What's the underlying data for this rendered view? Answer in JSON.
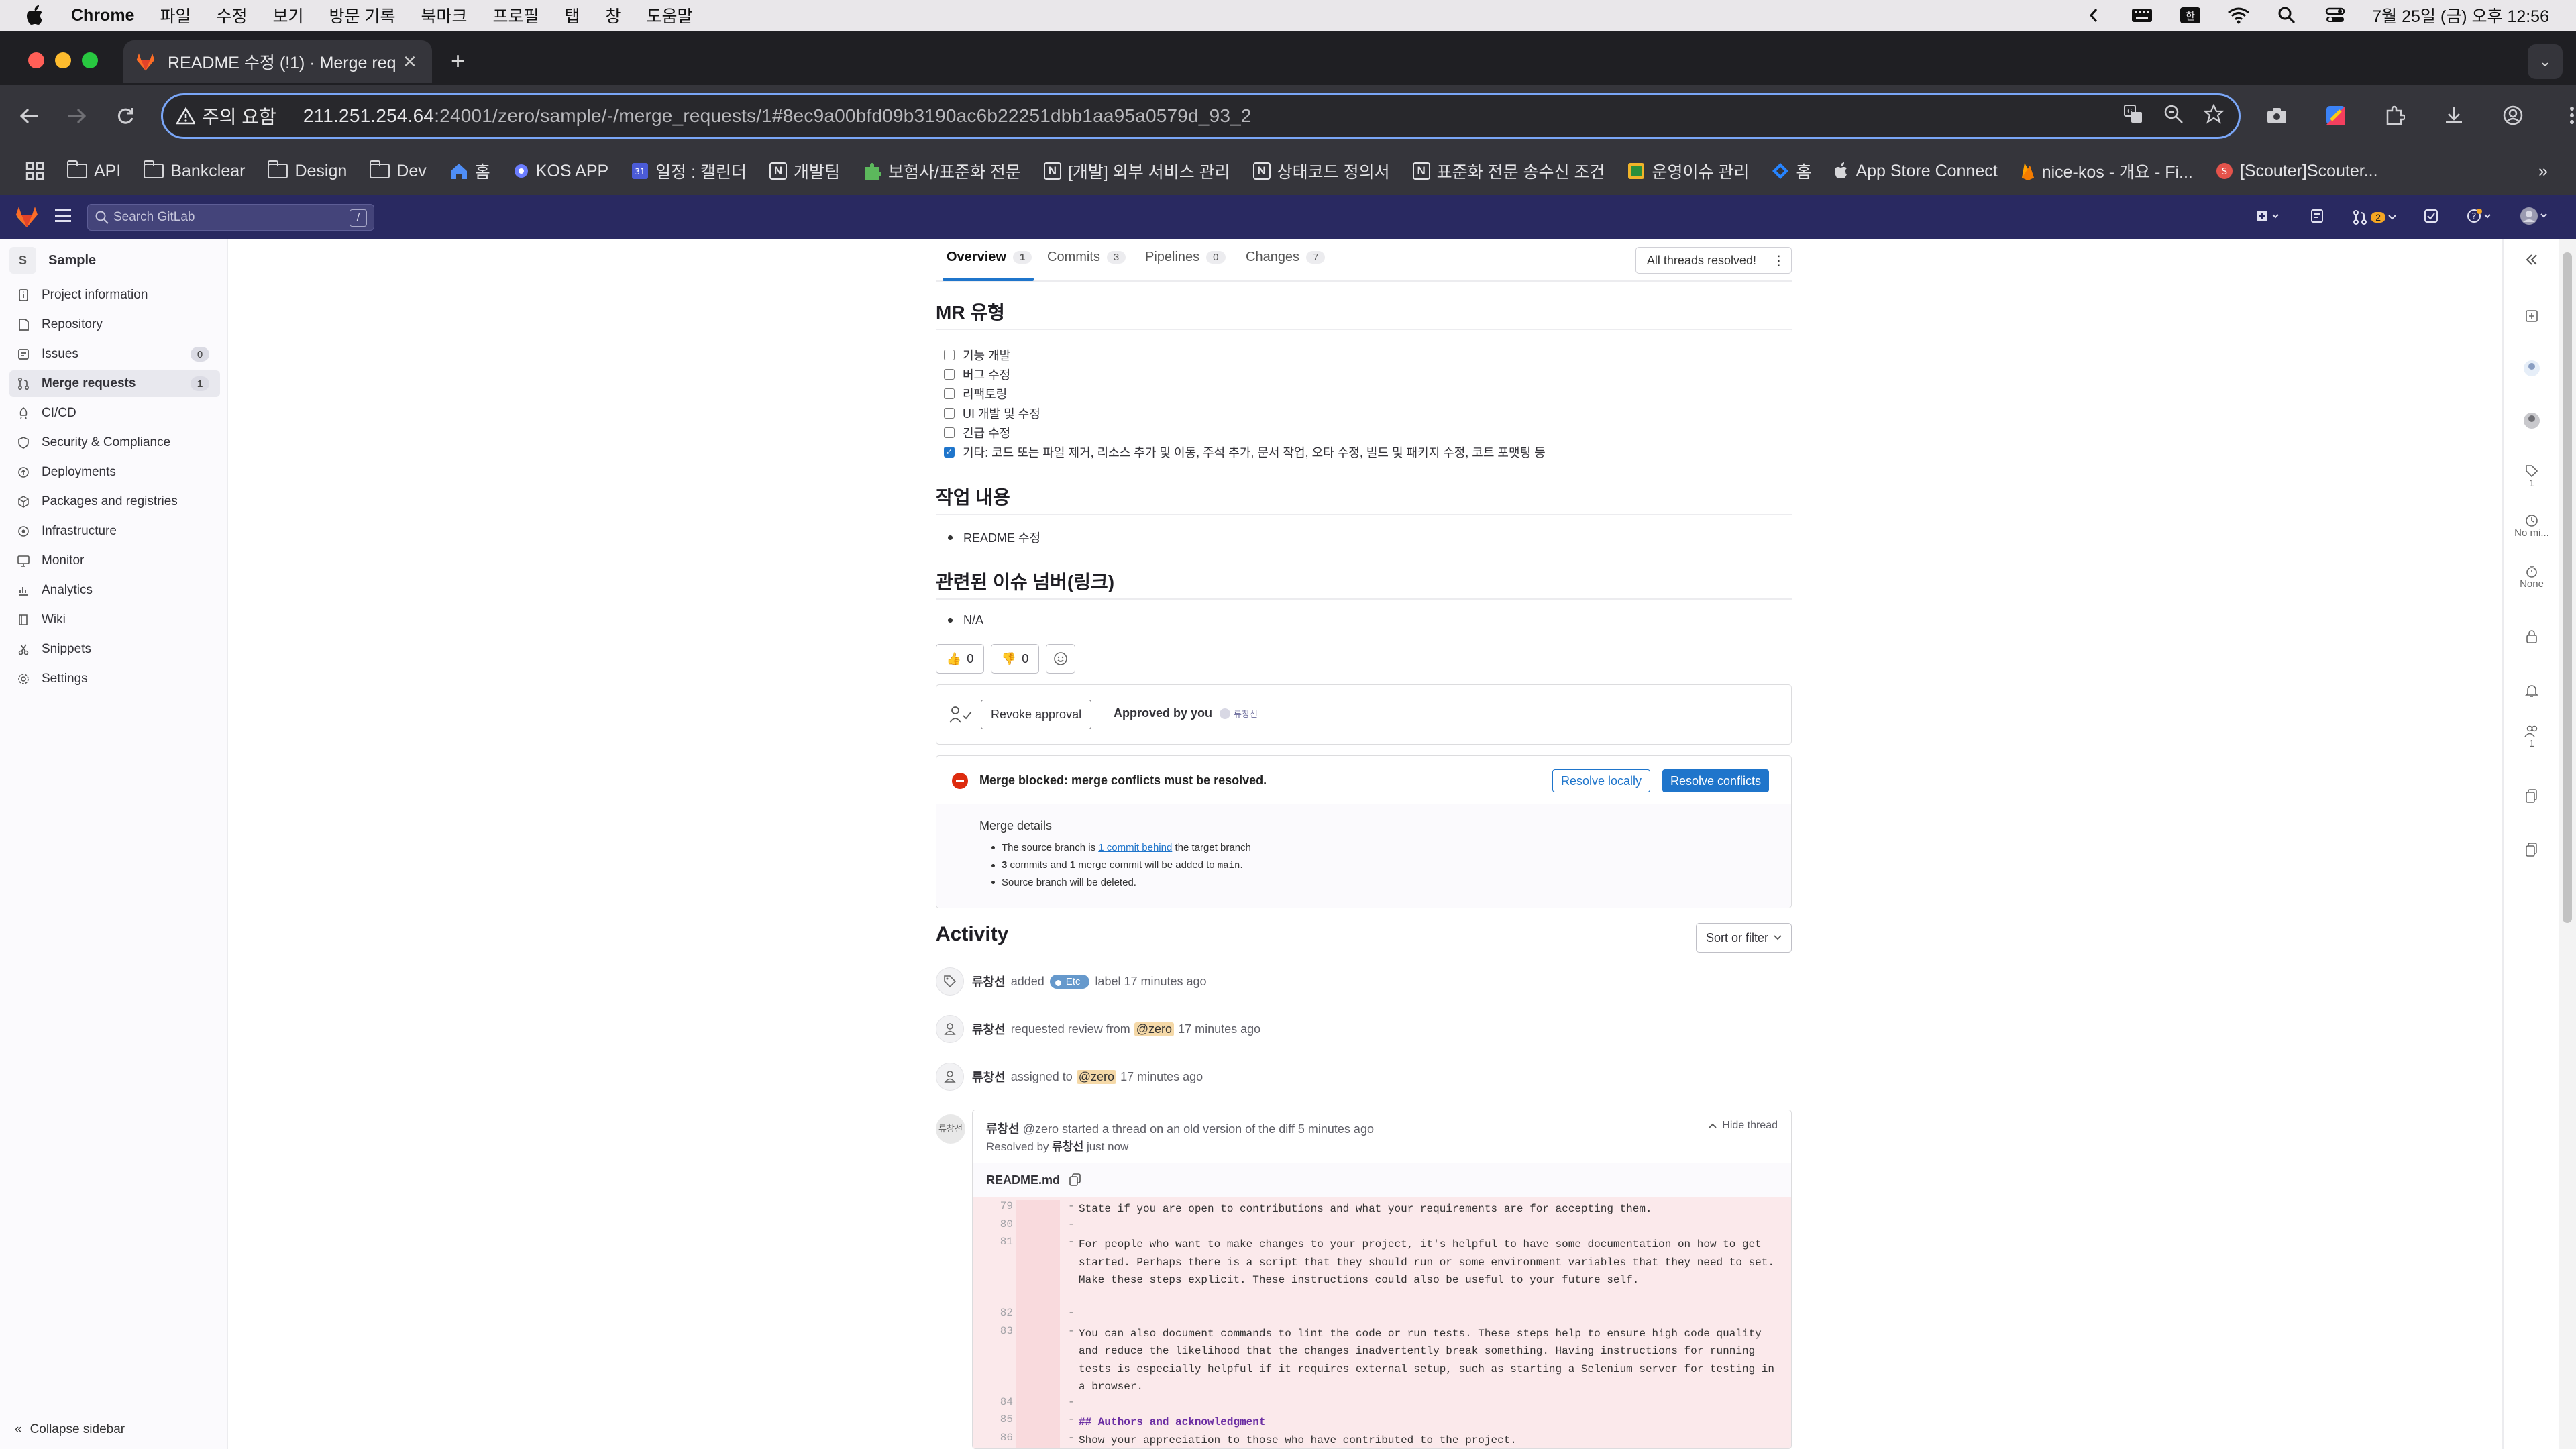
{
  "menubar": {
    "items": [
      "Chrome",
      "파일",
      "수정",
      "보기",
      "방문 기록",
      "북마크",
      "프로필",
      "탭",
      "창",
      "도움말"
    ],
    "datetime": "7월 25일 (금) 오후 12:56"
  },
  "browser": {
    "tab_title": "README 수정 (!1) · Merge requ",
    "warning": "주의 요함",
    "url_host": "211.251.254.64",
    "url_rest": ":24001/zero/sample/-/merge_requests/1#8ec9a00bfd09b3190ac6b22251dbb1aa95a0579d_93_2",
    "bookmarks": [
      {
        "label": "API",
        "icon": "folder-icon"
      },
      {
        "label": "Bankclear",
        "icon": "folder-icon"
      },
      {
        "label": "Design",
        "icon": "folder-icon"
      },
      {
        "label": "Dev",
        "icon": "folder-icon"
      },
      {
        "label": "홈",
        "icon": "home-icon"
      },
      {
        "label": "KOS APP",
        "icon": "app-icon"
      },
      {
        "label": "일정 : 캘린더",
        "icon": "calendar-icon"
      },
      {
        "label": "개발팀",
        "icon": "notion-icon"
      },
      {
        "label": "보험사/표준화 전문",
        "icon": "puzzle-icon"
      },
      {
        "label": "[개발] 외부 서비스 관리",
        "icon": "notion-icon"
      },
      {
        "label": "상태코드 정의서",
        "icon": "notion-icon"
      },
      {
        "label": "표준화 전문 송수신 조건",
        "icon": "notion-icon"
      },
      {
        "label": "운영이슈 관리",
        "icon": "sheet-icon"
      },
      {
        "label": "홈",
        "icon": "jira-icon"
      },
      {
        "label": "App Store Connect",
        "icon": "apple-icon"
      },
      {
        "label": "nice-kos - 개요 - Fi...",
        "icon": "firebase-icon"
      },
      {
        "label": "[Scouter]Scouter...",
        "icon": "scouter-icon"
      }
    ]
  },
  "gitlab": {
    "search_placeholder": "Search GitLab",
    "search_shortcut": "/",
    "merge_request_count": "2",
    "project": {
      "initial": "S",
      "name": "Sample"
    },
    "nav": [
      {
        "label": "Project information",
        "icon": "info-icon"
      },
      {
        "label": "Repository",
        "icon": "doc-icon"
      },
      {
        "label": "Issues",
        "icon": "issues-icon",
        "badge": "0"
      },
      {
        "label": "Merge requests",
        "icon": "merge-icon",
        "badge": "1",
        "active": true
      },
      {
        "label": "CI/CD",
        "icon": "rocket-icon"
      },
      {
        "label": "Security & Compliance",
        "icon": "shield-icon"
      },
      {
        "label": "Deployments",
        "icon": "deploy-icon"
      },
      {
        "label": "Packages and registries",
        "icon": "package-icon"
      },
      {
        "label": "Infrastructure",
        "icon": "cloud-icon"
      },
      {
        "label": "Monitor",
        "icon": "monitor-icon"
      },
      {
        "label": "Analytics",
        "icon": "chart-icon"
      },
      {
        "label": "Wiki",
        "icon": "book-icon"
      },
      {
        "label": "Snippets",
        "icon": "scissors-icon"
      },
      {
        "label": "Settings",
        "icon": "gear-icon"
      }
    ],
    "collapse_label": "Collapse sidebar"
  },
  "mr": {
    "tabs": [
      {
        "label": "Overview",
        "count": "1"
      },
      {
        "label": "Commits",
        "count": "3"
      },
      {
        "label": "Pipelines",
        "count": "0"
      },
      {
        "label": "Changes",
        "count": "7"
      }
    ],
    "threads_status": "All threads resolved!",
    "section1": "MR 유형",
    "checklist": [
      {
        "label": "기능 개발",
        "checked": false
      },
      {
        "label": "버그 수정",
        "checked": false
      },
      {
        "label": "리팩토링",
        "checked": false
      },
      {
        "label": "UI 개발 및 수정",
        "checked": false
      },
      {
        "label": "긴급 수정",
        "checked": false
      },
      {
        "label": "기타: 코드 또는 파일 제거, 리소스 추가 및 이동, 주석 추가, 문서 작업, 오타 수정, 빌드 및 패키지 수정, 코트 포맷팅 등",
        "checked": true
      }
    ],
    "section2": "작업 내용",
    "work_item": "README 수정",
    "section3": "관련된 이슈 넘버(링크)",
    "issue_item": "N/A",
    "thumbs_up": "0",
    "thumbs_down": "0",
    "revoke_label": "Revoke approval",
    "approved_by": "Approved by you",
    "approver_name": "류창선",
    "merge_blocked": "Merge blocked: merge conflicts must be resolved.",
    "resolve_locally": "Resolve locally",
    "resolve_conflicts": "Resolve conflicts",
    "merge_details_title": "Merge details",
    "md1_pre": "The source branch is ",
    "md1_link": "1 commit behind",
    "md1_post": " the target branch",
    "md2_a": "3",
    "md2_b": " commits and ",
    "md2_c": "1",
    "md2_d": " merge commit will be added to ",
    "md2_e": "main",
    "md2_f": ".",
    "md3": "Source branch will be deleted."
  },
  "activity": {
    "title": "Activity",
    "sort_label": "Sort or filter",
    "user": "류창선",
    "e1_action": "added",
    "e1_label": "Etc",
    "e1_rest": "label 17 minutes ago",
    "e2_action": "requested review from",
    "e2_mention": "@zero",
    "e2_time": "17 minutes ago",
    "e3_action": "assigned to",
    "e3_mention": "@zero",
    "e3_time": "17 minutes ago",
    "thread_avatar": "류창선",
    "thread_user": "류창선",
    "thread_text": "@zero started a thread on an old version of the diff 5 minutes ago",
    "resolved_prefix": "Resolved by",
    "resolved_user": "류창선",
    "resolved_time": "just now",
    "hide_thread": "Hide thread",
    "file": "README.md",
    "diff": [
      {
        "n": "79",
        "text": "State if you are open to contributions and what your requirements are for accepting them.",
        "rows": 1
      },
      {
        "n": "80",
        "text": "",
        "rows": 1
      },
      {
        "n": "81",
        "text": "For people who want to make changes to your project, it's helpful to have some documentation on how to get started. Perhaps there is a script that they should run or some environment variables that they need to set. Make these steps explicit. These instructions could also be useful to your future self.",
        "rows": 4
      },
      {
        "n": "82",
        "text": "",
        "rows": 1
      },
      {
        "n": "83",
        "text": "You can also document commands to lint the code or run tests. These steps help to ensure high code quality and reduce the likelihood that the changes inadvertently break something. Having instructions for running tests is especially helpful if it requires external setup, such as starting a Selenium server for testing in a browser.",
        "rows": 4
      },
      {
        "n": "84",
        "text": "",
        "rows": 1
      },
      {
        "n": "85",
        "text": "## Authors and acknowledgment",
        "rows": 1,
        "heading": true
      },
      {
        "n": "86",
        "text": "Show your appreciation to those who have contributed to the project.",
        "rows": 1
      }
    ]
  },
  "rail": {
    "labels_count": "1",
    "milestone": "No mi...",
    "time": "None",
    "participants": "1"
  }
}
